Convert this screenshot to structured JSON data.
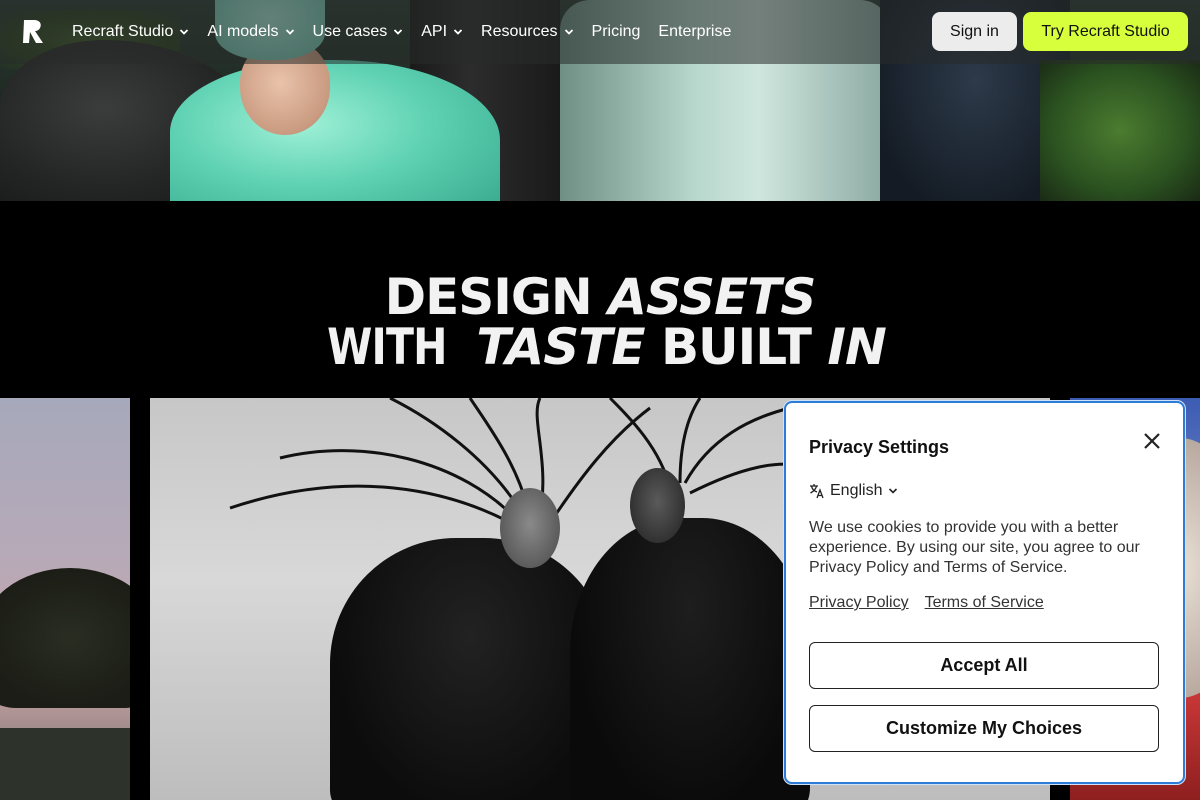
{
  "nav": {
    "logo_icon": "recraft-logo-icon",
    "items": [
      {
        "label": "Recraft Studio",
        "has_dropdown": true
      },
      {
        "label": "AI models",
        "has_dropdown": true
      },
      {
        "label": "Use cases",
        "has_dropdown": true
      },
      {
        "label": "API",
        "has_dropdown": true
      },
      {
        "label": "Resources",
        "has_dropdown": true
      },
      {
        "label": "Pricing",
        "has_dropdown": false
      },
      {
        "label": "Enterprise",
        "has_dropdown": false
      }
    ],
    "signin_label": "Sign in",
    "try_label": "Try Recraft Studio",
    "try_color": "#d8ff3b"
  },
  "headline": {
    "line1": {
      "word1": "DESIGN",
      "word2": "ASSETS"
    },
    "line2": {
      "word1": "WITH",
      "word2": "TASTE",
      "word3": "BUILT",
      "word4": "IN"
    }
  },
  "privacy": {
    "title": "Privacy Settings",
    "language": "English",
    "text": "We use cookies to provide you with a better experience. By using our site, you agree to our Privacy Policy and Terms of Service.",
    "links": [
      "Privacy Policy",
      "Terms of Service"
    ],
    "accept_label": "Accept All",
    "customize_label": "Customize My Choices",
    "border_color": "#2f7bd8"
  }
}
